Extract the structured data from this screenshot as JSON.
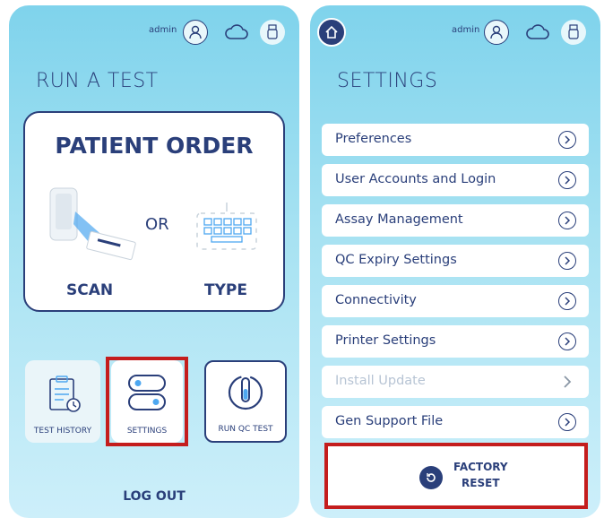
{
  "left_screen": {
    "header": {
      "user": "admin",
      "icons": [
        "user-settings-icon",
        "cloud-icon",
        "usb-icon"
      ]
    },
    "title": "RUN A TEST",
    "patient_order": {
      "title": "PATIENT ORDER",
      "or": "OR",
      "scan": "SCAN",
      "type": "TYPE"
    },
    "tiles": [
      {
        "label": "TEST HISTORY",
        "icon": "clipboard-clock-icon"
      },
      {
        "label": "SETTINGS",
        "icon": "toggle-switches-icon"
      },
      {
        "label": "RUN QC TEST",
        "icon": "test-tube-icon"
      }
    ],
    "logout": "LOG OUT"
  },
  "right_screen": {
    "header": {
      "user": "admin",
      "icons": [
        "home-icon",
        "user-settings-icon",
        "cloud-icon",
        "usb-icon"
      ]
    },
    "title": "SETTINGS",
    "items": [
      {
        "label": "Preferences",
        "enabled": true
      },
      {
        "label": "User Accounts and Login",
        "enabled": true
      },
      {
        "label": "Assay Management",
        "enabled": true
      },
      {
        "label": "QC Expiry Settings",
        "enabled": true
      },
      {
        "label": "Connectivity",
        "enabled": true
      },
      {
        "label": "Printer Settings",
        "enabled": true
      },
      {
        "label": "Install Update",
        "enabled": false
      },
      {
        "label": "Gen Support File",
        "enabled": true
      }
    ],
    "factory_reset": {
      "line1": "FACTORY",
      "line2": "RESET"
    }
  },
  "colors": {
    "primary": "#2a3f7a",
    "highlight": "#c41d1d",
    "panel_top": "#7fd3ec",
    "panel_bottom": "#cdeffa"
  }
}
